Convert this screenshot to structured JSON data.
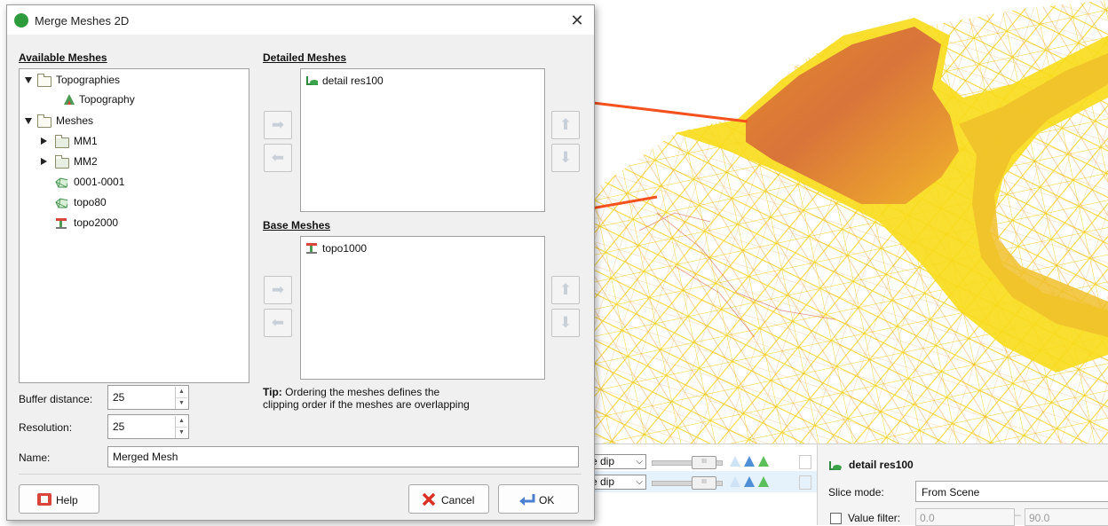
{
  "dialog": {
    "title": "Merge Meshes 2D",
    "close_glyph": "✕",
    "available_header": "Available Meshes",
    "available_tree": {
      "topographies": "Topographies",
      "topography": "Topography",
      "meshes": "Meshes",
      "mm1": "MM1",
      "mm2": "MM2",
      "m0001": "0001-0001",
      "topo80": "topo80",
      "topo2000": "topo2000"
    },
    "detailed_header": "Detailed Meshes",
    "detailed_items": [
      "detail res100"
    ],
    "base_header": "Base Meshes",
    "base_items": [
      "topo1000"
    ],
    "tip_label": "Tip:",
    "tip_line1": " Ordering the meshes defines the",
    "tip_line2": "clipping order if the meshes are overlapping",
    "buffer_label": "Buffer distance:",
    "buffer_value": "25",
    "resolution_label": "Resolution:",
    "resolution_value": "25",
    "name_label": "Name:",
    "name_value": "Merged Mesh",
    "help_label": "Help",
    "cancel_label": "Cancel",
    "ok_label": "OK"
  },
  "lower_panel": {
    "rows": [
      {
        "combo": "e dip"
      },
      {
        "combo": "e dip"
      }
    ]
  },
  "properties": {
    "object_name": "detail res100",
    "slice_mode_label": "Slice mode:",
    "slice_mode_value": "From Scene",
    "value_filter_label": "Value filter:",
    "value_filter_min": "0.0",
    "value_filter_max": "90.0"
  },
  "colors": {
    "annotation_arrow": "#f4511e",
    "mesh_yellow": "#f8dc1a",
    "mesh_orange": "#e8752a"
  }
}
